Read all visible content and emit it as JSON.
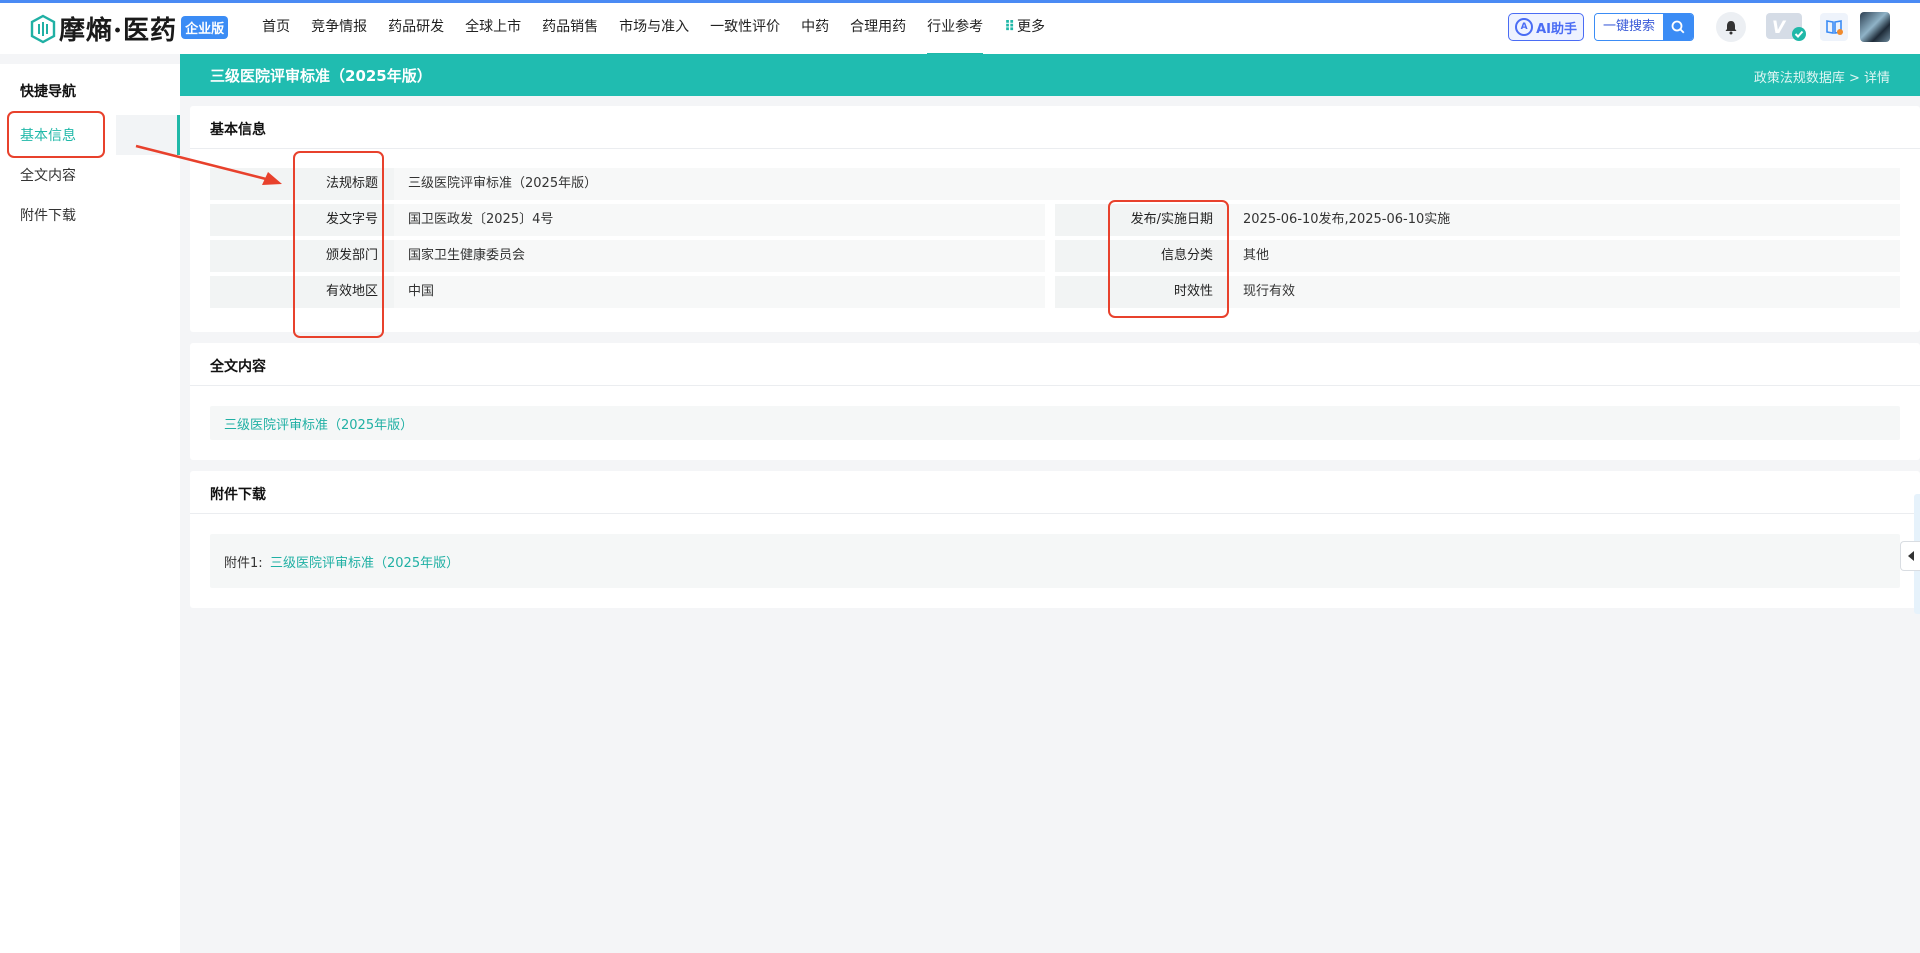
{
  "brand": {
    "name": "摩熵·医药",
    "edition": "企业版"
  },
  "nav": {
    "items": [
      "首页",
      "竞争情报",
      "药品研发",
      "全球上市",
      "药品销售",
      "市场与准入",
      "一致性评价",
      "中药",
      "合理用药",
      "行业参考"
    ],
    "active": "行业参考",
    "more_label": "更多"
  },
  "toolbar": {
    "ai_label": "AI助手",
    "search_label": "一键搜索"
  },
  "sidebar": {
    "title": "快捷导航",
    "items": [
      {
        "label": "基本信息",
        "active": true
      },
      {
        "label": "全文内容",
        "active": false
      },
      {
        "label": "附件下载",
        "active": false
      }
    ]
  },
  "header": {
    "title": "三级医院评审标准（2025年版）",
    "breadcrumb": "政策法规数据库 > 详情"
  },
  "basic_info": {
    "title": "基本信息",
    "rows": [
      {
        "label": "法规标题",
        "value": "三级医院评审标准（2025年版）"
      },
      {
        "label": "发文字号",
        "value": "国卫医政发〔2025〕4号",
        "label2": "发布/实施日期",
        "value2": "2025-06-10发布,2025-06-10实施"
      },
      {
        "label": "颁发部门",
        "value": "国家卫生健康委员会",
        "label2": "信息分类",
        "value2": "其他"
      },
      {
        "label": "有效地区",
        "value": "中国",
        "label2": "时效性",
        "value2": "现行有效"
      }
    ]
  },
  "full_text": {
    "title": "全文内容",
    "link": "三级医院评审标准（2025年版）"
  },
  "attachments": {
    "title": "附件下载",
    "prefix": "附件1:",
    "link": "三级医院评审标准（2025年版）"
  },
  "colors": {
    "accent": "#20bcb0",
    "annotation": "#e8412c",
    "brand_blue": "#3b8cf5"
  }
}
